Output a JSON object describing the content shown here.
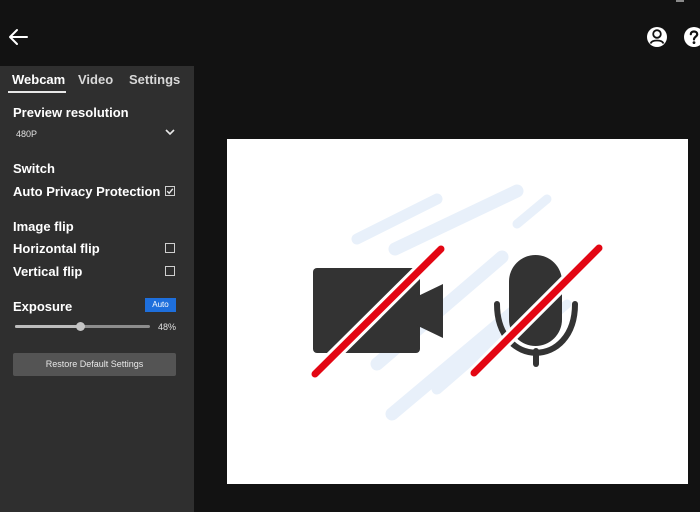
{
  "header": {
    "back_icon": "arrow-left-icon",
    "account_icon": "user-circle-icon",
    "help_icon": "question-circle-icon"
  },
  "tabs": [
    {
      "label": "Webcam",
      "active": true
    },
    {
      "label": "Video",
      "active": false
    },
    {
      "label": "Settings",
      "active": false
    }
  ],
  "webcam": {
    "preview_resolution": {
      "title": "Preview resolution",
      "value": "480P"
    },
    "switch": {
      "title": "Switch",
      "auto_privacy_label": "Auto Privacy Protection",
      "auto_privacy_checked": true
    },
    "image_flip": {
      "title": "Image flip",
      "horizontal_label": "Horizontal flip",
      "horizontal_checked": false,
      "vertical_label": "Vertical flip",
      "vertical_checked": false
    },
    "exposure": {
      "title": "Exposure",
      "auto_label": "Auto",
      "value_text": "48%",
      "value": 48
    },
    "restore_label": "Restore Default Settings"
  },
  "preview": {
    "camera_icon": "video-camera-off-icon",
    "mic_icon": "microphone-off-icon",
    "colors": {
      "icon": "#333333",
      "slash": "#e30613",
      "streaks": "#e8f0fa"
    }
  },
  "colors": {
    "accent": "#1e6fdc",
    "sidebar": "#2f2f2f",
    "background": "#121212"
  }
}
